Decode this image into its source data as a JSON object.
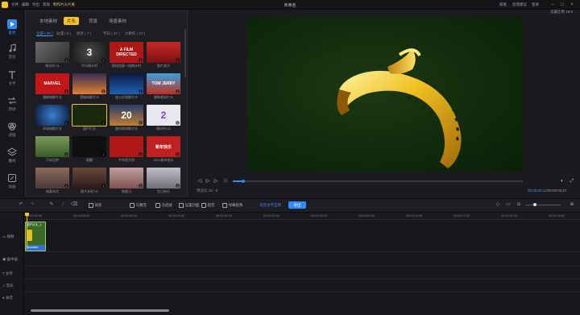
{
  "window": {
    "title": "未命名",
    "menu": [
      "文件",
      "编辑",
      "导出",
      "帮助",
      "制作片头片尾"
    ],
    "right_links": [
      "新版",
      "反馈建议",
      "登录"
    ]
  },
  "rail": [
    {
      "label": "素材",
      "icon": "media-icon",
      "active": true
    },
    {
      "label": "音乐",
      "icon": "music-icon"
    },
    {
      "label": "文字",
      "icon": "text-icon"
    },
    {
      "label": "转场",
      "icon": "transition-icon"
    },
    {
      "label": "滤镜",
      "icon": "filter-icon"
    },
    {
      "label": "叠附",
      "icon": "overlay-icon"
    },
    {
      "label": "动画",
      "icon": "animation-icon"
    }
  ],
  "media": {
    "tabs": [
      "本地素材",
      "片头",
      "背景",
      "场景素材"
    ],
    "active_tab": 1,
    "filters": [
      "全部 ( 90 )",
      "动漫 ( 6 )",
      "搞笑 ( 7 )",
      "节日 ( 27 )",
      "大制作 ( 27 )"
    ],
    "active_filter": 0,
    "thumbs": [
      {
        "caption": "倒计时 01",
        "bg": "linear-gradient(135deg,#6a6a6a,#2e2e2e)"
      },
      {
        "caption": "中乐倒计时",
        "bg": "radial-gradient(circle,#4a4a4a,#1a1a1a)",
        "text": "3"
      },
      {
        "caption": "搞怪创意一组倒计时",
        "bg": "#b01818",
        "text": "A FILM DIRECTED"
      },
      {
        "caption": "胶片放大",
        "bg": "linear-gradient(180deg,#c62828,#7a1010)"
      },
      {
        "caption": "漫威电影片头",
        "bg": "#b71c1c",
        "text": "MARVEL"
      },
      {
        "caption": "宽幅电影片头",
        "bg": "linear-gradient(180deg,#3a2a50,#e08030)"
      },
      {
        "caption": "迪士尼电影片头",
        "bg": "linear-gradient(180deg,#0a1a4a,#2060b0)"
      },
      {
        "caption": "猫和老鼠片头",
        "bg": "linear-gradient(180deg,#3aa0e0,#c03020)",
        "text": "TOM JERRY"
      },
      {
        "caption": "环球电影片头",
        "bg": "radial-gradient(circle,#3a80d0,#0a1a3a)"
      },
      {
        "caption": "国产片头",
        "bg": "#1a2a0a",
        "selected": true
      },
      {
        "caption": "福克斯电影片头",
        "bg": "linear-gradient(180deg,#2a3a6a,#c08030)",
        "text": "20"
      },
      {
        "caption": "倒计时 02",
        "bg": "#e8e8ec",
        "text": "2"
      },
      {
        "caption": "万年历梦",
        "bg": "linear-gradient(180deg,#7a9a5a,#3a5a2a)"
      },
      {
        "caption": "烟雾",
        "bg": "#101010"
      },
      {
        "caption": "牛年贺大财",
        "bg": "#b01818"
      },
      {
        "caption": "2021新年快乐",
        "bg": "#c02020",
        "text": "新年快乐"
      },
      {
        "caption": "纯真年代",
        "bg": "linear-gradient(180deg,#8a6a5a,#4a3a3a)"
      },
      {
        "caption": "胶片计时 02",
        "bg": "linear-gradient(180deg,#6a4a3a,#2a1a1a)"
      },
      {
        "caption": "和夏日",
        "bg": "linear-gradient(180deg,#c0a0a0,#805050)"
      },
      {
        "caption": "生日快乐",
        "bg": "linear-gradient(180deg,#c0c0c8,#707078)"
      }
    ]
  },
  "preview": {
    "ratio": "设置比例 16:9",
    "quality": "预览比 16 : 9",
    "time_current": "00:00:00.11",
    "time_total": "00:00:06.07",
    "progress": 0.11
  },
  "toolbar": {
    "tools": [
      "裁剪",
      "马赛克",
      "冻结帧",
      "设置封面",
      "配音",
      "绿幕抠像"
    ],
    "ai_label": "语音文字互转",
    "export_label": "导出"
  },
  "timeline": {
    "ticks": [
      "00:00:00.00",
      "00:00:08.00",
      "00:00:16.00",
      "00:00:24.00",
      "00:00:32.00",
      "00:00:40.00",
      "00:00:48.00",
      "00:00:56.00",
      "00:01:04.00",
      "00:01:12.00",
      "00:01:20.00",
      "00:01:28.00"
    ],
    "tracks": [
      "视频",
      "画中画",
      "文字",
      "音乐",
      "录音"
    ],
    "clip_name": "国产片头_1",
    "clip_sub": "Mountain"
  }
}
